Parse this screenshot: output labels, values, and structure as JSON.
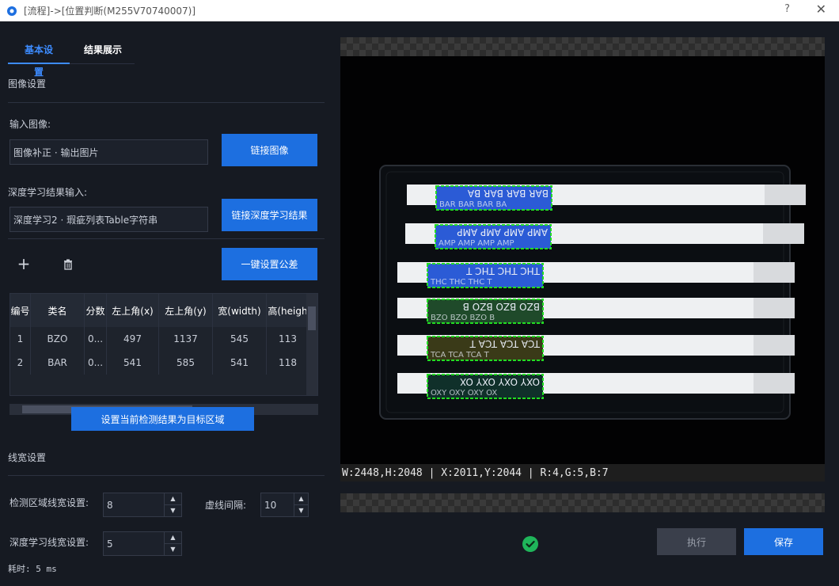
{
  "window": {
    "title": "[流程]->[位置判断(M255V70740007)]",
    "help": "?",
    "close": "✕"
  },
  "tabs": [
    {
      "label": "基本设置",
      "active": true
    },
    {
      "label": "结果展示",
      "active": false
    }
  ],
  "image_settings": {
    "section_title": "图像设置",
    "input_image_label": "输入图像:",
    "input_image_value": "图像补正 · 输出图片",
    "link_image_button": "链接图像",
    "dl_result_label": "深度学习结果输入:",
    "dl_result_value": "深度学习2 · 瑕疵列表Table字符串",
    "link_dl_button": "链接深度学习结果"
  },
  "toolbar": {
    "add": "+",
    "delete": "🗑",
    "set_tolerance_button": "一键设置公差"
  },
  "table": {
    "columns": [
      "编号",
      "类名",
      "分数",
      "左上角(x)",
      "左上角(y)",
      "宽(width)",
      "高(heigh"
    ],
    "rows": [
      [
        "1",
        "BZO",
        "0...",
        "497",
        "1137",
        "545",
        "113"
      ],
      [
        "2",
        "BAR",
        "0...",
        "541",
        "585",
        "541",
        "118"
      ]
    ]
  },
  "set_target_button": "设置当前检测结果为目标区域",
  "line_settings": {
    "section_title": "线宽设置",
    "detect_width_label": "检测区域线宽设置:",
    "detect_width_value": "8",
    "dash_gap_label": "虚线间隔:",
    "dash_gap_value": "10",
    "dl_width_label": "深度学习线宽设置:",
    "dl_width_value": "5"
  },
  "elapsed": "耗时: 5 ms",
  "viewer": {
    "readout": "W:2448,H:2048 | X:2011,Y:2044 | R:4,G:5,B:7",
    "strips": [
      {
        "text": "BAR BAR BAR BA",
        "color": "#2b5bd6"
      },
      {
        "text": "AMP AMP AMP AMP",
        "color": "#2b5bd6"
      },
      {
        "text": "THC THC THC T",
        "color": "#2b5bd6"
      },
      {
        "text": "BZO BZO BZO B",
        "color": "#1f4a2a"
      },
      {
        "text": "TCA TCA TCA T",
        "color": "#3a3a18"
      },
      {
        "text": "OXY OXY OXY OX",
        "color": "#10302a"
      }
    ]
  },
  "actions": {
    "execute": "执行",
    "save": "保存"
  },
  "colors": {
    "accent": "#1d6fe0",
    "tab_active": "#3d8cff",
    "detection_box": "#22dd22",
    "ok": "#1fb55a"
  }
}
